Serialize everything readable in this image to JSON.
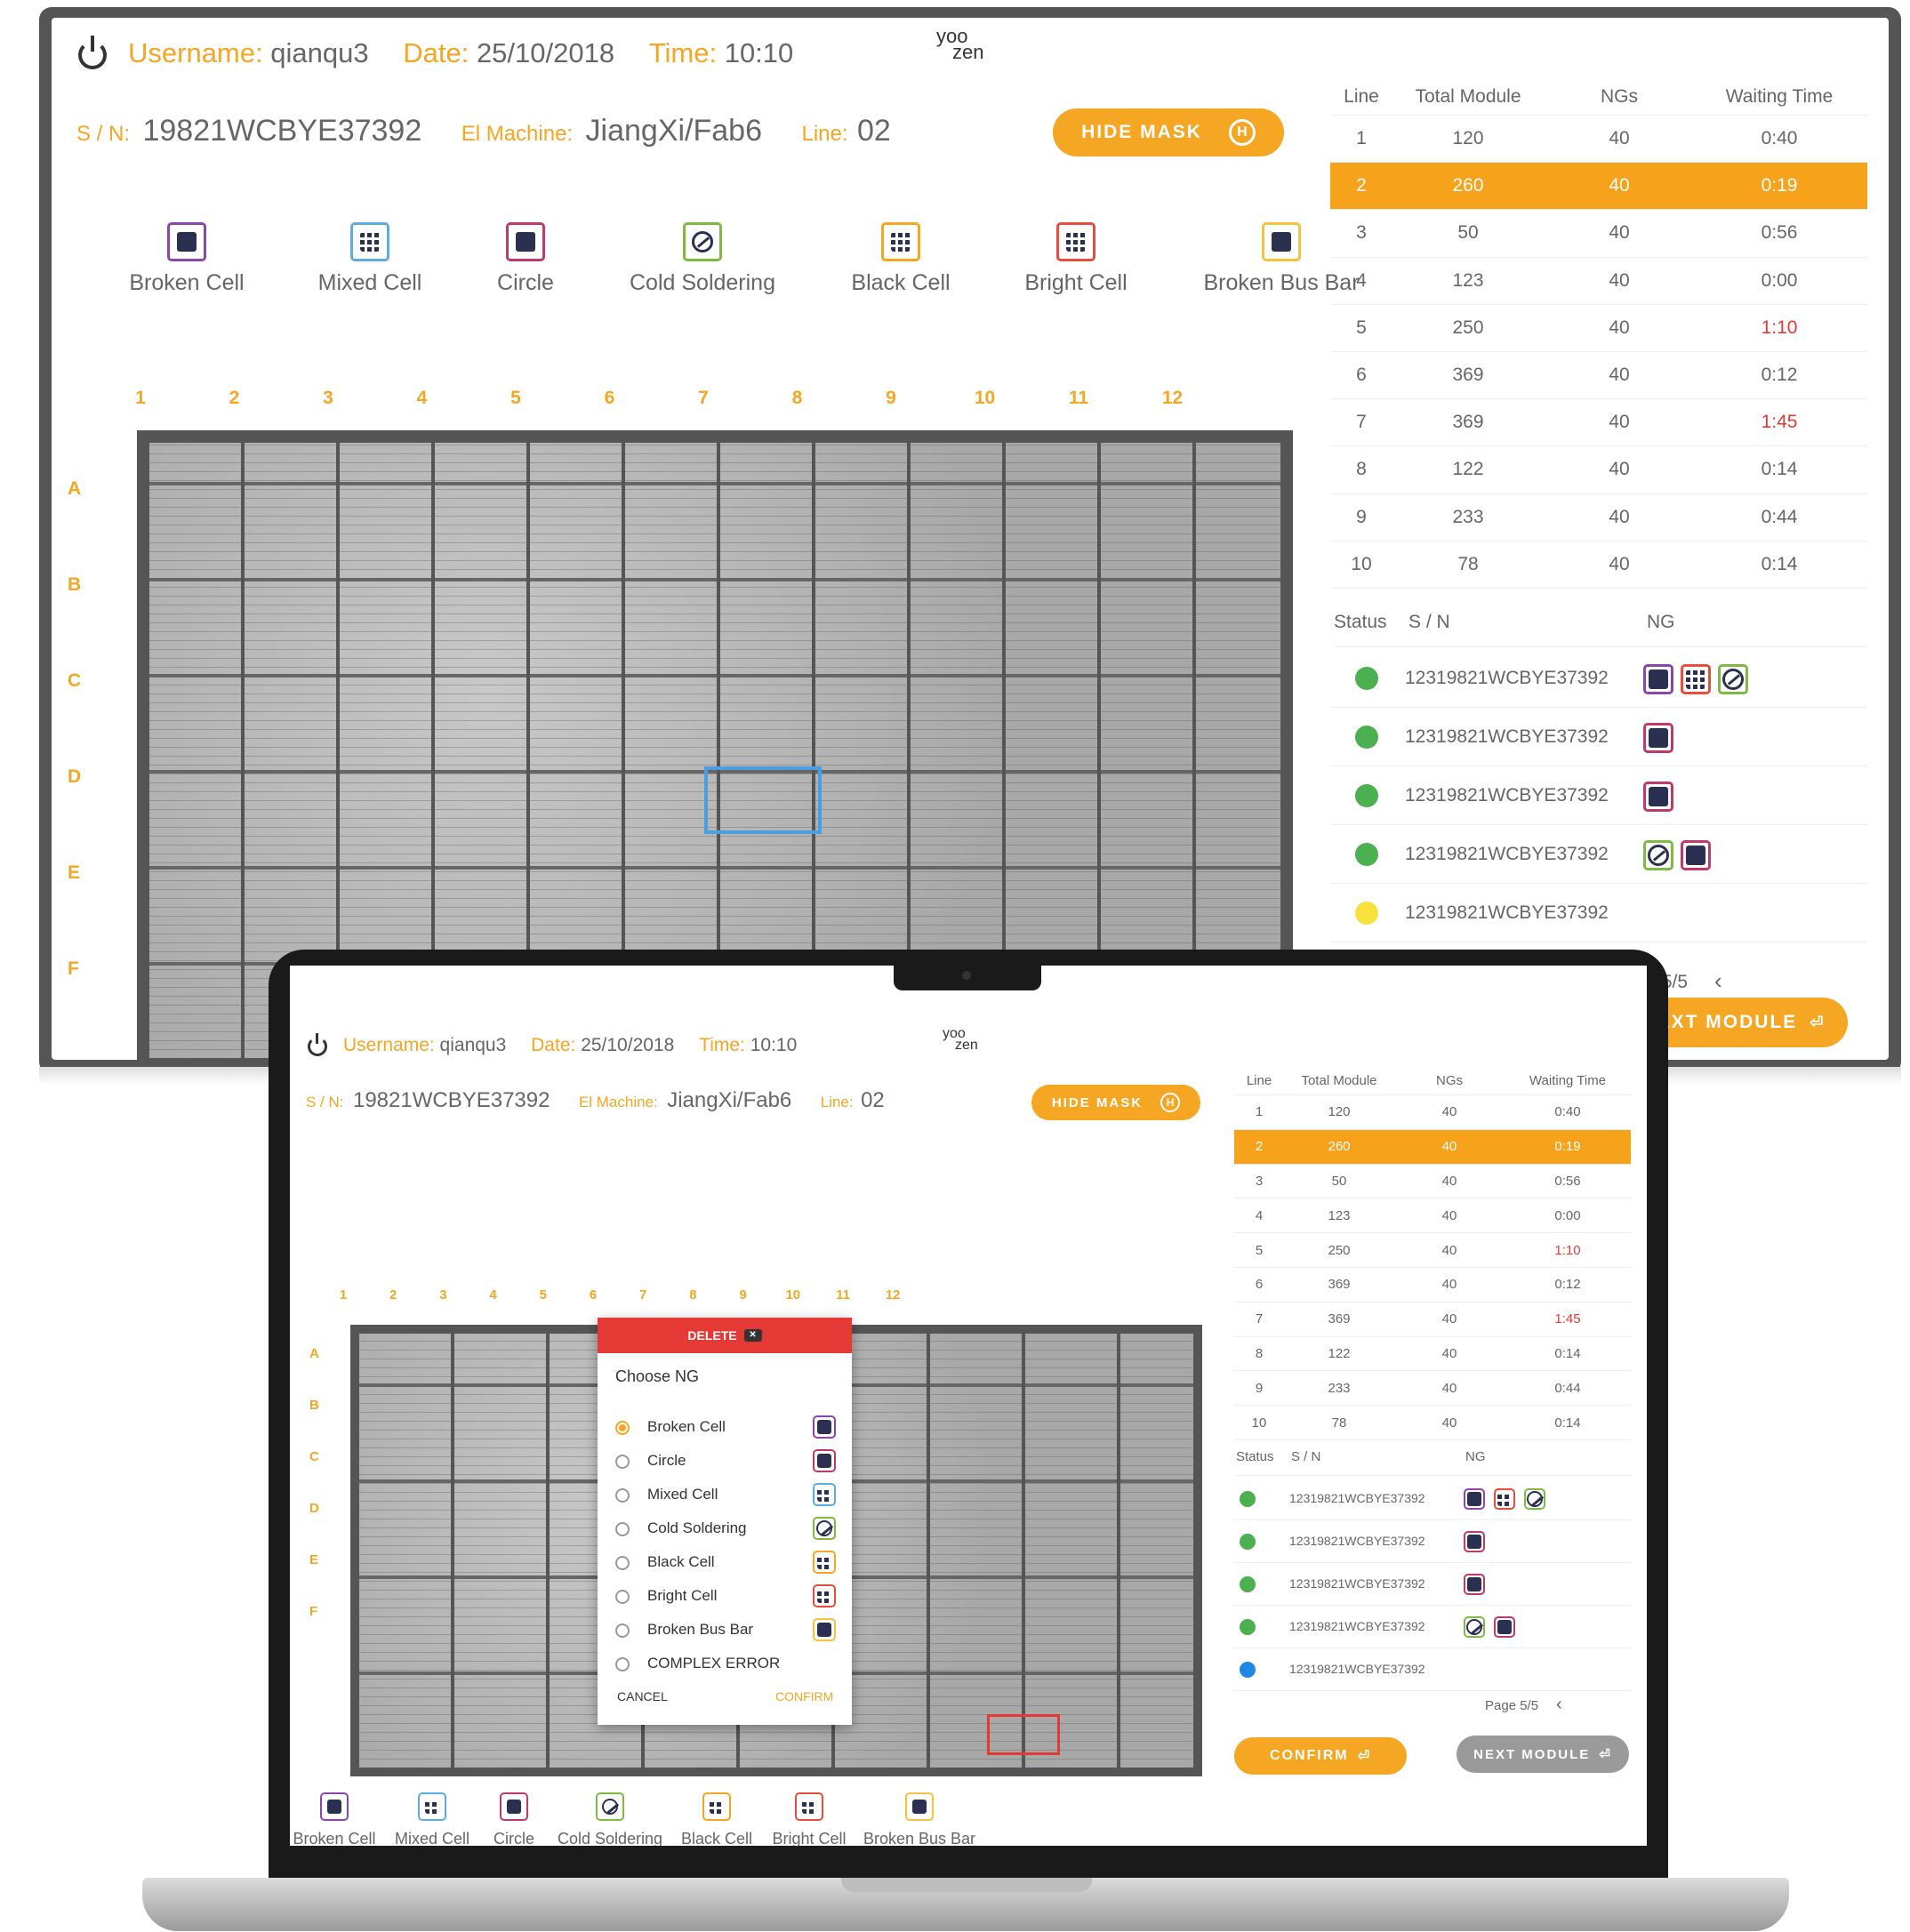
{
  "header": {
    "power_icon": "power-icon",
    "username_label": "Username:",
    "username": "qianqu3",
    "date_label": "Date:",
    "date": "25/10/2018",
    "time_label": "Time:",
    "time": "10:10",
    "logo_top": "yoo",
    "logo_bottom": "zen",
    "sn_label": "S / N:",
    "sn": "19821WCBYE37392",
    "machine_label": "El Machine:",
    "machine": "JiangXi/Fab6",
    "line_label": "Line:",
    "line": "02",
    "hide_mask": "HIDE MASK",
    "hide_mask_key": "H"
  },
  "ng_types": [
    {
      "label": "Broken Cell",
      "icon": "broken-cell-icon",
      "color": "#8e44ad"
    },
    {
      "label": "Mixed Cell",
      "icon": "mixed-cell-icon",
      "color": "#5dade2"
    },
    {
      "label": "Circle",
      "icon": "circle-icon",
      "color": "#c0396b"
    },
    {
      "label": "Cold Soldering",
      "icon": "cold-soldering-icon",
      "color": "#7dbb42"
    },
    {
      "label": "Black Cell",
      "icon": "black-cell-icon",
      "color": "#f5a623"
    },
    {
      "label": "Bright Cell",
      "icon": "bright-cell-icon",
      "color": "#e74c3c"
    },
    {
      "label": "Broken Bus Bar",
      "icon": "broken-bus-bar-icon",
      "color": "#f5c242"
    }
  ],
  "grid": {
    "cols": [
      "1",
      "2",
      "3",
      "4",
      "5",
      "6",
      "7",
      "8",
      "9",
      "10",
      "11",
      "12"
    ],
    "rows": [
      "A",
      "B",
      "C",
      "D",
      "E",
      "F"
    ]
  },
  "table": {
    "headers": [
      "Line",
      "Total Module",
      "NGs",
      "Waiting Time"
    ],
    "rows": [
      [
        "1",
        "120",
        "40",
        "0:40"
      ],
      [
        "2",
        "260",
        "40",
        "0:19"
      ],
      [
        "3",
        "50",
        "40",
        "0:56"
      ],
      [
        "4",
        "123",
        "40",
        "0:00"
      ],
      [
        "5",
        "250",
        "40",
        "1:10"
      ],
      [
        "6",
        "369",
        "40",
        "0:12"
      ],
      [
        "7",
        "369",
        "40",
        "1:45"
      ],
      [
        "8",
        "122",
        "40",
        "0:14"
      ],
      [
        "9",
        "233",
        "40",
        "0:44"
      ],
      [
        "10",
        "78",
        "40",
        "0:14"
      ]
    ]
  },
  "status": {
    "headers": [
      "Status",
      "S / N",
      "NG"
    ],
    "sn": "12319821WCBYE37392",
    "page": "Page 5/5",
    "prev": "‹"
  },
  "dialog": {
    "delete": "DELETE",
    "title": "Choose NG",
    "options": [
      "Broken Cell",
      "Circle",
      "Mixed Cell",
      "Cold Soldering",
      "Black Cell",
      "Bright Cell",
      "Broken Bus Bar",
      "COMPLEX ERROR"
    ],
    "cancel": "CANCEL",
    "confirm": "CONFIRM"
  },
  "buttons": {
    "confirm": "CONFIRM",
    "next_module": "NEXT MODULE",
    "next_module_cut": "EXT MODULE"
  },
  "colors": {
    "accent": "#f5a623",
    "green": "#4caf50",
    "yellow": "#f7e23c",
    "blue": "#1e88e5",
    "red": "#e53935"
  }
}
